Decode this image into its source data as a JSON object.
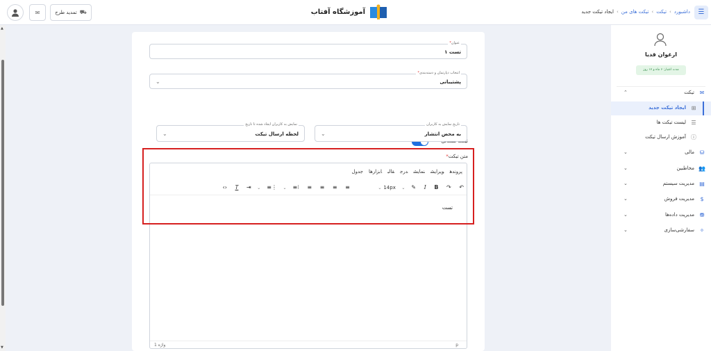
{
  "header": {
    "breadcrumb": [
      "داشبورد",
      "تیکت",
      "تیکت های من",
      "ایجاد تیکت جدید"
    ],
    "brand": "آموزشگاه آفتاب",
    "renew_label": "تمدید طرح",
    "menu_icon": "menu-icon",
    "mail_icon": "mail-icon",
    "avatar_icon": "user-icon"
  },
  "form": {
    "title_label": "عنوان",
    "title_value": "تست ۱",
    "department_label": "انتخاب دپارتمان و دسته‌بندی",
    "department_value": "پشتیبانی",
    "public_label": "تیکت همگانی",
    "public_on": true,
    "show_date_label": "تاریخ نمایش به کاربران",
    "show_date_value": "به محض انتشار",
    "show_until_label": "نمایش به کاربران ایجاد شده تا تاریخ",
    "show_until_value": "لحظه ارسال تیکت",
    "editor_label": "متن تیکت"
  },
  "editor": {
    "menus": [
      "پرونده",
      "ویرایش",
      "نمایش",
      "درج",
      "قالب",
      "ابزارها",
      "جدول"
    ],
    "font_size": "14px",
    "content": "تست",
    "word_count": "1 واژه",
    "path": "p"
  },
  "sidebar": {
    "user_name": "ارغوان قدیا",
    "credit": "مدت اعتبار: ۶ ماه و ۱۷ روز",
    "items": [
      {
        "label": "تیکت",
        "icon": "mail-icon",
        "arrow": "⌃"
      },
      {
        "label": "ایجاد تیکت جدید",
        "icon": "plus-square-icon"
      },
      {
        "label": "لیست تیکت ها",
        "icon": "list-icon"
      },
      {
        "label": "آموزش ارسال تیکت",
        "icon": "info-icon"
      },
      {
        "label": "مالی",
        "icon": "coins-icon",
        "arrow": "⌄"
      },
      {
        "label": "مخاطبین",
        "icon": "users-icon",
        "arrow": "⌄"
      },
      {
        "label": "مدیریت سیستم",
        "icon": "server-icon",
        "arrow": "⌄"
      },
      {
        "label": "مدیریت فروش",
        "icon": "dollar-icon",
        "arrow": "⌄"
      },
      {
        "label": "مدیریت داده‌ها",
        "icon": "database-icon",
        "arrow": "⌄"
      },
      {
        "label": "سفارشی‌سازی",
        "icon": "wand-icon",
        "arrow": "⌄"
      }
    ]
  },
  "colors": {
    "accent": "#1e6fe0",
    "highlight_box": "#d61f1f",
    "credit_bg": "#e3f5e6"
  }
}
